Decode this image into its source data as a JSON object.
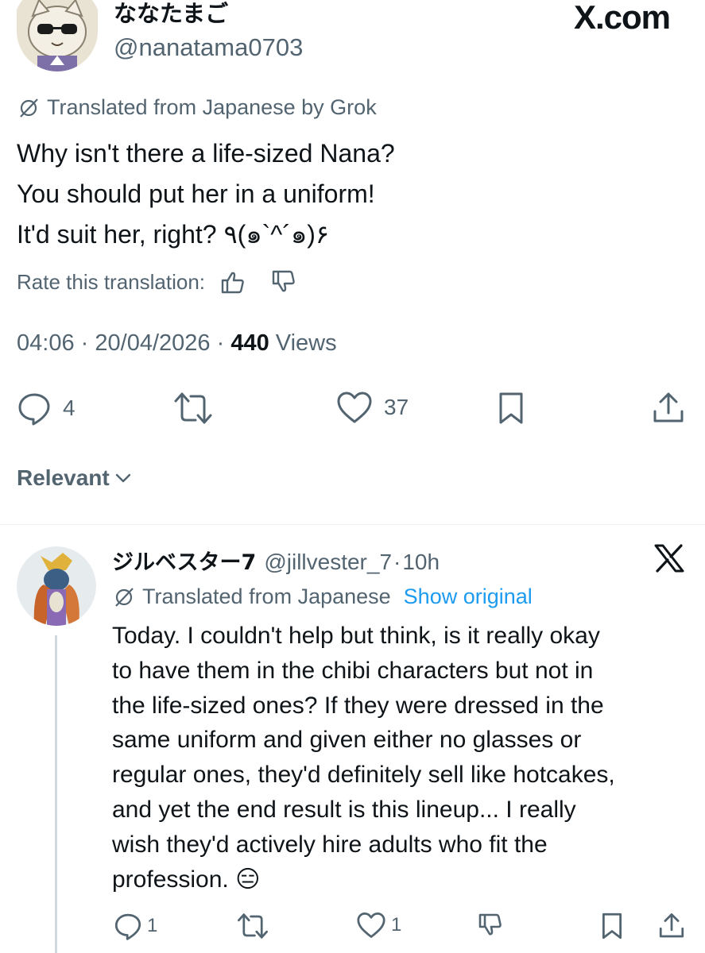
{
  "brand": "X.com",
  "main_tweet": {
    "author_name": "ななたまご",
    "author_handle": "@nanatama0703",
    "avatar_icon": "cat-avatar-icon",
    "translated_label": "Translated from Japanese by Grok",
    "text_lines": [
      "Why isn't there a life-sized Nana?",
      "You should put her in a uniform!",
      "It'd suit her, right? ٩(๑`^´๑)۶"
    ],
    "rate_label": "Rate this translation:",
    "time": "04:06",
    "date": "20/04/2026",
    "views_count": "440",
    "views_label": "Views",
    "separator": "·",
    "stats": {
      "replies": "4",
      "retweets": "",
      "likes": "37"
    }
  },
  "filter": {
    "label": "Relevant"
  },
  "reply": {
    "author_name": "ジルベスター7",
    "author_handle": "@jillvester_7",
    "separator": "·",
    "time_ago": "10h",
    "avatar_icon": "character-avatar-icon",
    "translated_label": "Translated from Japanese",
    "show_original": "Show original",
    "text_lines": [
      "Today. I couldn't help but think, is it really okay",
      "to have them in the chibi characters but not in",
      "the life-sized ones? If they were dressed in the",
      "same uniform and given either no glasses or",
      "regular ones, they'd definitely sell like hotcakes,",
      "and yet the end result is this lineup... I really",
      "wish they'd actively hire adults who fit the",
      "profession."
    ],
    "emoji": "😑",
    "stats": {
      "replies": "1",
      "retweets": "",
      "likes": "1"
    }
  },
  "colors": {
    "text": "#0f1419",
    "secondary": "#536471",
    "link": "#1d9bf0",
    "divider": "#eff3f4",
    "thread_line": "#cfd9de"
  }
}
